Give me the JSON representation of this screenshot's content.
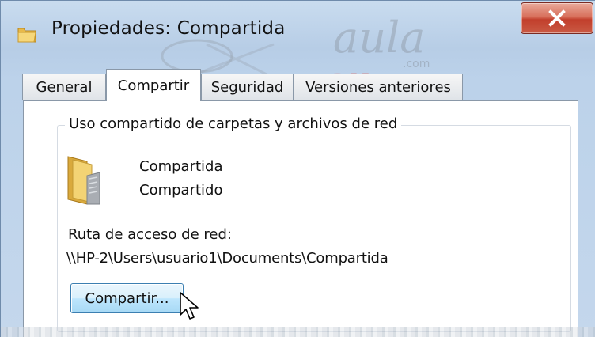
{
  "window": {
    "title": "Propiedades: Compartida",
    "close_glyph": "X",
    "watermark": {
      "line1": "aula",
      "line2": ".com",
      "line3": "Clic"
    }
  },
  "tabs": [
    {
      "label": "General",
      "active": false
    },
    {
      "label": "Compartir",
      "active": true
    },
    {
      "label": "Seguridad",
      "active": false
    },
    {
      "label": "Versiones anteriores",
      "active": false
    }
  ],
  "sharing": {
    "group_label": "Uso compartido de carpetas y archivos de red",
    "folder_name": "Compartida",
    "folder_status": "Compartido",
    "network_path_label": "Ruta de acceso de red:",
    "network_path": "\\\\HP-2\\Users\\usuario1\\Documents\\Compartida",
    "share_button_label": "Compartir..."
  },
  "icons": {
    "title_icon": "folder-icon",
    "content_icon": "shared-folder-icon",
    "cursor": "mouse-pointer-icon"
  },
  "colors": {
    "close_button": "#c94a35",
    "share_button": "#bee6fd",
    "frame": "#bcd2ea"
  }
}
